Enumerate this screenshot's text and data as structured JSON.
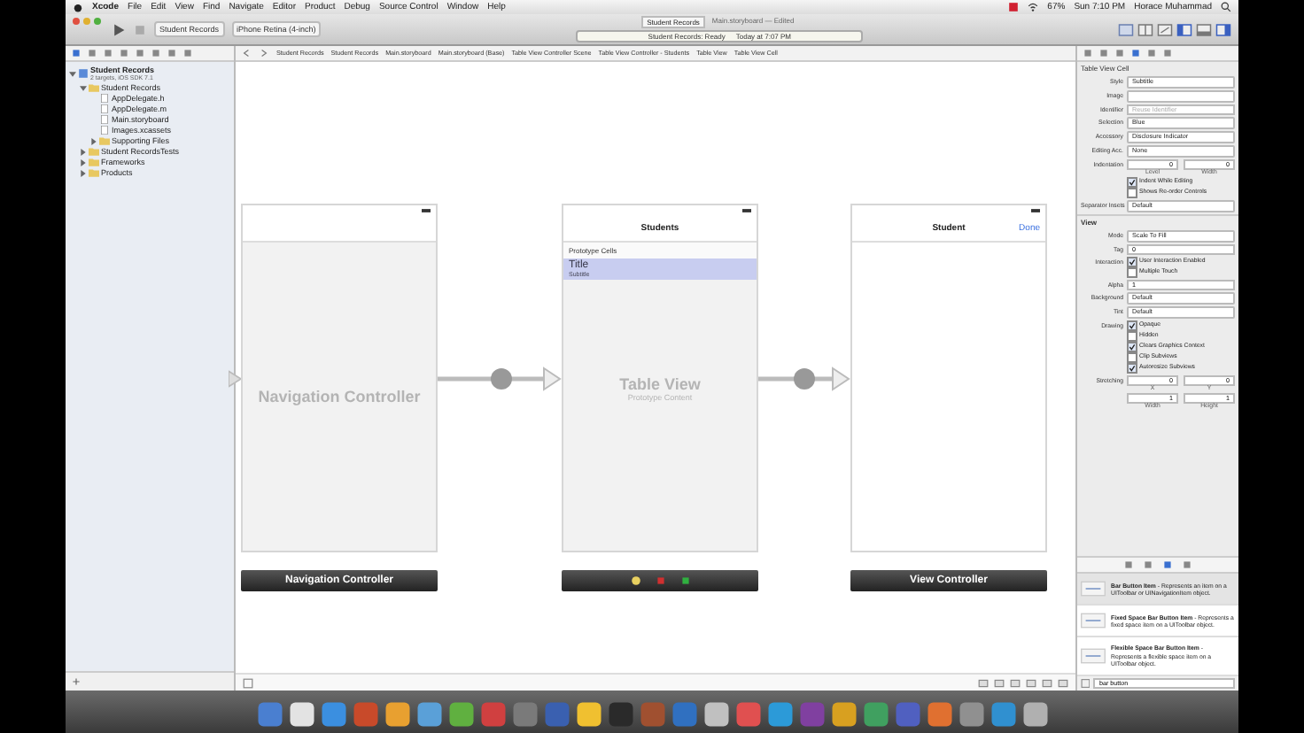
{
  "menubar": {
    "items": [
      "Xcode",
      "File",
      "Edit",
      "View",
      "Find",
      "Navigate",
      "Editor",
      "Product",
      "Debug",
      "Source Control",
      "Window",
      "Help"
    ],
    "battery": "67%",
    "clock": "Sun 7:10 PM",
    "user": "Horace Muhammad"
  },
  "toolbar": {
    "scheme": "Student Records",
    "device": "iPhone Retina (4-inch)",
    "title_tabs": [
      {
        "label": "Student Records",
        "selected": true
      },
      {
        "label": "Main.storyboard — Edited",
        "selected": false
      }
    ],
    "activity": "Student Records: Ready",
    "activity_time": "Today at 7:07 PM"
  },
  "jump_bar": [
    "Student Records",
    "Student Records",
    "Main.storyboard",
    "Main.storyboard (Base)",
    "Table View Controller Scene",
    "Table View Controller - Students",
    "Table View",
    "Table View Cell"
  ],
  "navigator": {
    "items": [
      {
        "label": "Student Records",
        "subtitle": "2 targets, iOS SDK 7.1",
        "kind": "project",
        "expanded": true,
        "children": [
          {
            "label": "Student Records",
            "kind": "folder",
            "expanded": true,
            "children": [
              {
                "label": "AppDelegate.h",
                "kind": "file"
              },
              {
                "label": "AppDelegate.m",
                "kind": "file"
              },
              {
                "label": "Main.storyboard",
                "kind": "file"
              },
              {
                "label": "Images.xcassets",
                "kind": "file"
              },
              {
                "label": "Supporting Files",
                "kind": "folder",
                "expanded": false
              }
            ]
          },
          {
            "label": "Student RecordsTests",
            "kind": "folder",
            "expanded": false
          },
          {
            "label": "Frameworks",
            "kind": "folder",
            "expanded": false
          },
          {
            "label": "Products",
            "kind": "folder",
            "expanded": false
          }
        ]
      }
    ]
  },
  "scenes": [
    {
      "kind": "navigation",
      "placeholder": "Navigation Controller",
      "label": "Navigation Controller"
    },
    {
      "kind": "table",
      "nav_title": "Students",
      "section": "Prototype Cells",
      "cell_title": "Title",
      "cell_subtitle": "Subtitle",
      "placeholder": "Table View",
      "placeholder_sub": "Prototype Content"
    },
    {
      "kind": "view",
      "nav_title": "Student",
      "nav_button": "Done",
      "label": "View Controller"
    }
  ],
  "inspector": {
    "title": "Table View Cell",
    "rows": [
      {
        "kind": "select",
        "label": "Style",
        "value": "Subtitle"
      },
      {
        "kind": "select",
        "label": "Image",
        "value": ""
      },
      {
        "kind": "field",
        "label": "Identifier",
        "placeholder": "Reuse Identifier"
      },
      {
        "kind": "select",
        "label": "Selection",
        "value": "Blue"
      },
      {
        "kind": "select",
        "label": "Accessory",
        "value": "Disclosure Indicator"
      },
      {
        "kind": "select",
        "label": "Editing Acc.",
        "value": "None"
      },
      {
        "kind": "pair",
        "label": "Indentation",
        "values": [
          "0",
          "0"
        ],
        "sublabels": [
          "Level",
          "Width"
        ]
      },
      {
        "kind": "check",
        "label": "",
        "checks": [
          {
            "label": "Indent While Editing",
            "checked": true
          },
          {
            "label": "Shows Re-order Controls",
            "checked": false
          }
        ]
      },
      {
        "kind": "select",
        "label": "Separator Insets",
        "value": "Default"
      },
      {
        "kind": "section",
        "label": "View"
      },
      {
        "kind": "select",
        "label": "Mode",
        "value": "Scale To Fill"
      },
      {
        "kind": "field",
        "label": "Tag",
        "value": "0"
      },
      {
        "kind": "check",
        "label": "Interaction",
        "checks": [
          {
            "label": "User Interaction Enabled",
            "checked": true
          },
          {
            "label": "Multiple Touch",
            "checked": false
          }
        ]
      },
      {
        "kind": "field",
        "label": "Alpha",
        "value": "1"
      },
      {
        "kind": "select",
        "label": "Background",
        "value": "Default"
      },
      {
        "kind": "select",
        "label": "Tint",
        "value": "Default"
      },
      {
        "kind": "check",
        "label": "Drawing",
        "checks": [
          {
            "label": "Opaque",
            "checked": true
          },
          {
            "label": "Hidden",
            "checked": false
          },
          {
            "label": "Clears Graphics Context",
            "checked": true
          },
          {
            "label": "Clip Subviews",
            "checked": false
          },
          {
            "label": "Autoresize Subviews",
            "checked": true
          }
        ]
      },
      {
        "kind": "pair",
        "label": "Stretching",
        "values": [
          "0",
          "0"
        ],
        "sublabels": [
          "X",
          "Y"
        ]
      },
      {
        "kind": "pair",
        "label": "",
        "values": [
          "1",
          "1"
        ],
        "sublabels": [
          "Width",
          "Height"
        ]
      }
    ],
    "library": [
      {
        "text": "**Bar Button Item** - Represents an item on a UIToolbar or UINavigationItem object."
      },
      {
        "text": "**Fixed Space Bar Button Item** - Represents a fixed space item on a UIToolbar object."
      },
      {
        "text": "**Flexible Space Bar Button Item** - Represents a flexible space item on a UIToolbar object."
      }
    ],
    "library_filter": "bar button"
  }
}
